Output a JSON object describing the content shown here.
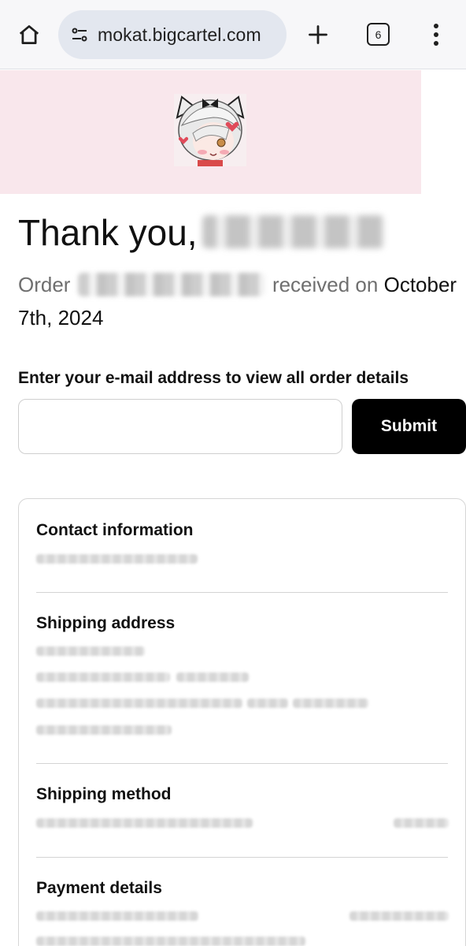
{
  "browser": {
    "url": "mokat.bigcartel.com",
    "tab_count": "6",
    "icons": [
      "home-icon",
      "site-settings-icon",
      "plus-icon",
      "tabs-icon",
      "more-vert-icon"
    ]
  },
  "store": {
    "header_bg": "#f9e7ec",
    "logo": "store-logo"
  },
  "confirmation": {
    "greeting": "Thank you,",
    "order_prefix": "Order",
    "order_suffix": "received on",
    "order_date": "October 7th, 2024"
  },
  "email_form": {
    "label": "Enter your e-mail address to view all order details",
    "input_value": "",
    "input_placeholder": "",
    "submit_label": "Submit"
  },
  "details": {
    "contact": {
      "title": "Contact information"
    },
    "shipping_address": {
      "title": "Shipping address"
    },
    "shipping_method": {
      "title": "Shipping method"
    },
    "payment": {
      "title": "Payment details"
    }
  },
  "colors": {
    "accent_button": "#000000",
    "header_pink": "#f9e7ec",
    "muted_text": "#6f6f6f"
  }
}
